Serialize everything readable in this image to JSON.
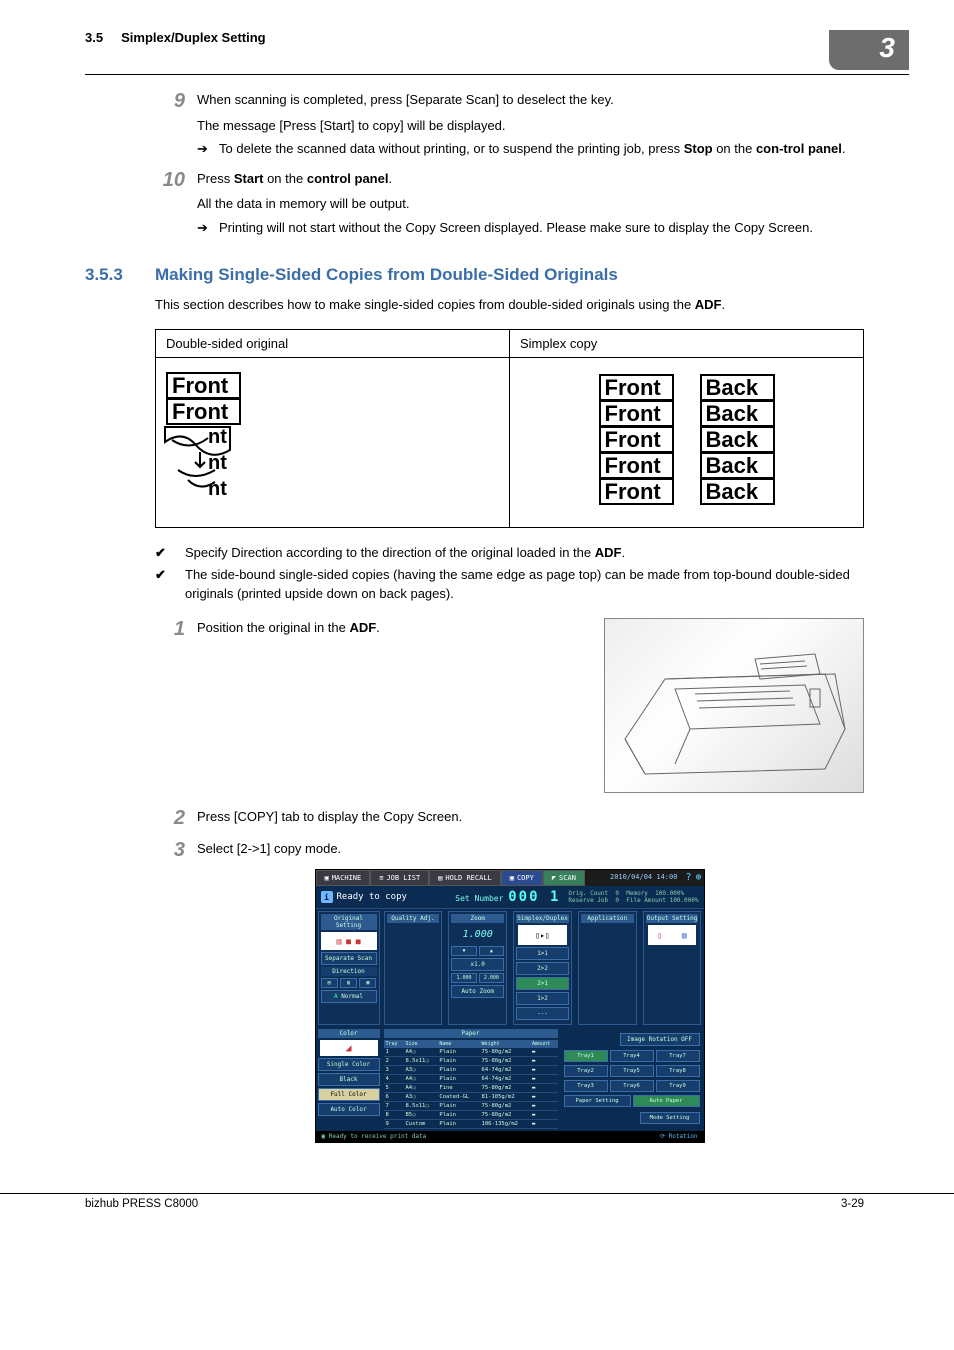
{
  "header": {
    "section_num": "3.5",
    "section_title": "Simplex/Duplex Setting",
    "chapter_badge": "3"
  },
  "step9": {
    "num": "9",
    "text": "When scanning is completed, press [Separate Scan] to deselect the key.",
    "sub1": "The message [Press [Start] to copy] will be displayed.",
    "arrow_text_a": "To delete the scanned data without printing, or to suspend the printing job, press ",
    "arrow_bold_a": "Stop",
    "arrow_text_b": " on the ",
    "arrow_bold_b": "con-trol panel",
    "arrow_text_c": "."
  },
  "step10": {
    "num": "10",
    "text_a": "Press ",
    "bold_a": "Start",
    "text_b": " on the ",
    "bold_b": "control panel",
    "text_c": ".",
    "sub1": "All the data in memory will be output.",
    "arrow_text": "Printing will not start without the Copy Screen displayed. Please make sure to display the Copy Screen."
  },
  "section": {
    "num": "3.5.3",
    "title": "Making Single-Sided Copies from Double-Sided Originals",
    "intro_a": "This section describes how to make single-sided copies from double-sided originals using the ",
    "intro_b": "ADF",
    "intro_c": "."
  },
  "table_headers": {
    "left": "Double-sided original",
    "right": "Simplex copy"
  },
  "labels": {
    "front": "Front",
    "back": "Back",
    "nt": "nt"
  },
  "checks": {
    "c1_a": "Specify Direction according to the direction of the original loaded in the ",
    "c1_b": "ADF",
    "c1_c": ".",
    "c2": "The side-bound single-sided copies (having the same edge as page top) can be made from top-bound double-sided originals (printed upside down on back pages)."
  },
  "step1": {
    "num": "1",
    "text_a": "Position the original in the ",
    "bold_a": "ADF",
    "text_b": "."
  },
  "step2": {
    "num": "2",
    "text": "Press [COPY] tab to display the Copy Screen."
  },
  "step3": {
    "num": "3",
    "text": "Select [2->1] copy mode."
  },
  "screenshot": {
    "tabs": {
      "machine": "MACHINE",
      "joblist": "JOB LIST",
      "holdrecall": "HOLD RECALL",
      "copy": "COPY",
      "scan": "SCAN"
    },
    "datetime": "2010/04/04 14:00",
    "ready": "Ready to copy",
    "setnum_label": "Set Number",
    "setnum_val": "000 1",
    "meta": {
      "orig_count": "Orig. Count",
      "orig_count_v": "0",
      "memory": "Memory",
      "memory_v": "100.000%",
      "reserve": "Reserve Job",
      "reserve_v": "0",
      "file_amount": "File Amount 100.000%"
    },
    "panels": {
      "original": "Original Setting",
      "quality": "Quality Adj.",
      "zoom": "Zoom",
      "simplex": "Simplex/Duplex",
      "application": "Application",
      "output": "Output Setting",
      "separate_scan": "Separate Scan",
      "direction": "Direction",
      "normal": "Normal",
      "ratio": "1.000",
      "x10": "x1.0",
      "r1": "1.000",
      "r2": "2.000",
      "autozoom": "Auto Zoom",
      "b11": "1>1",
      "b22": "2>2",
      "b21": "2>1",
      "b12": "1>2",
      "bdash": "---"
    },
    "color": {
      "heading": "Color",
      "single": "Single Color",
      "black": "Black",
      "full": "Full Color",
      "auto": "Auto Color"
    },
    "paper": {
      "heading": "Paper",
      "cols": {
        "tray": "Tray",
        "size": "Size",
        "name": "Name",
        "weight": "Weight",
        "amount": "Amount"
      },
      "rows": [
        {
          "tray": "1",
          "size": "A4❏",
          "name": "Plain",
          "weight": "75-80g/m2"
        },
        {
          "tray": "2",
          "size": "8.5x11❏",
          "name": "Plain",
          "weight": "75-80g/m2"
        },
        {
          "tray": "3",
          "size": "A3❏",
          "name": "Plain",
          "weight": "64-74g/m2"
        },
        {
          "tray": "4",
          "size": "A4❏",
          "name": "Plain",
          "weight": "64-74g/m2"
        },
        {
          "tray": "5",
          "size": "A4❏",
          "name": "Fine",
          "weight": "75-80g/m2"
        },
        {
          "tray": "6",
          "size": "A3❏",
          "name": "Coated-GL",
          "weight": "81-105g/m2"
        },
        {
          "tray": "7",
          "size": "8.5x11❏",
          "name": "Plain",
          "weight": "75-80g/m2"
        },
        {
          "tray": "8",
          "size": "B5❏",
          "name": "Plain",
          "weight": "75-80g/m2"
        },
        {
          "tray": "9",
          "size": "Custom",
          "name": "Plain",
          "weight": "106-135g/m2"
        }
      ],
      "image_rot": "Image Rotation OFF",
      "trays": [
        "Tray1",
        "Tray4",
        "Tray7",
        "Tray2",
        "Tray5",
        "Tray8",
        "Tray3",
        "Tray6",
        "Tray9"
      ],
      "paper_setting": "Paper Setting",
      "auto_paper": "Auto Paper",
      "mode_setting": "Mode Setting"
    },
    "footer": {
      "left": "Ready to receive print data",
      "right": "Rotation"
    }
  },
  "footer": {
    "left": "bizhub PRESS C8000",
    "right": "3-29"
  }
}
